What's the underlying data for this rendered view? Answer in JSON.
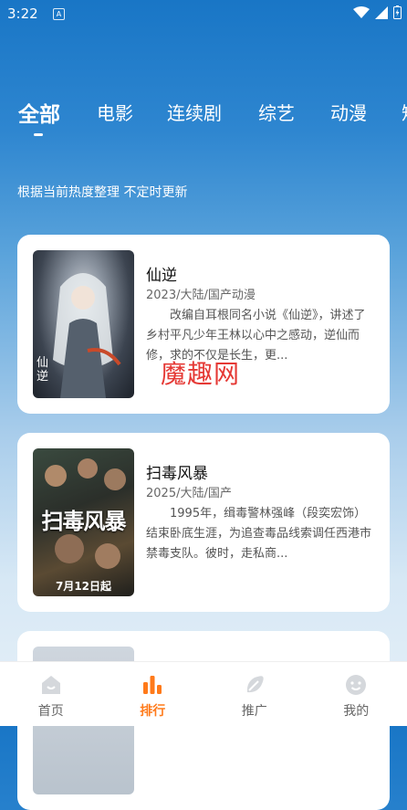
{
  "status": {
    "time": "3:22",
    "app_badge": "A"
  },
  "tabs": [
    {
      "label": "全部"
    },
    {
      "label": "电影"
    },
    {
      "label": "连续剧"
    },
    {
      "label": "综艺"
    },
    {
      "label": "动漫"
    },
    {
      "label": "短"
    }
  ],
  "subtitle": "根据当前热度整理 不定时更新",
  "cards": [
    {
      "title": "仙逆",
      "meta": "2023/大陆/国产动漫",
      "desc": "改编自耳根同名小说《仙逆》，讲述了乡村平凡少年王林以心中之感动，逆仙而修，求的不仅是长生，更...",
      "poster_text": "仙逆"
    },
    {
      "title": "扫毒风暴",
      "meta": "2025/大陆/国产",
      "desc": "1995年，缉毒警林强峰（段奕宏饰）结束卧底生涯，为追查毒品线索调任西港市禁毒支队。彼时，走私商...",
      "poster_text": "扫毒风暴",
      "poster_date": "7月12日起"
    }
  ],
  "watermark": "魔趣网",
  "bottom_nav": [
    {
      "label": "首页",
      "icon": "home-icon"
    },
    {
      "label": "排行",
      "icon": "ranking-icon"
    },
    {
      "label": "推广",
      "icon": "promote-icon"
    },
    {
      "label": "我的",
      "icon": "profile-icon"
    }
  ],
  "colors": {
    "accent": "#FF7A1A",
    "watermark": "#E53935",
    "header_blue": "#1976C6"
  }
}
